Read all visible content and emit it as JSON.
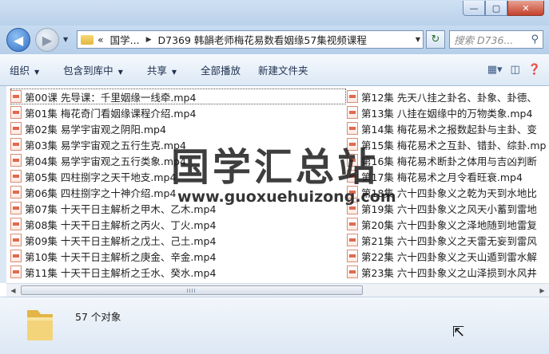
{
  "window": {
    "minimize": "—",
    "maximize": "▢",
    "close": "✕"
  },
  "nav": {
    "back": "◀",
    "forward": "▶",
    "dropdown": "▼"
  },
  "address": {
    "overflow": "«",
    "crumbs": [
      "国学...",
      "D7369 韩韻老师梅花易数看姻缘57集视频课程"
    ],
    "separator": "▶"
  },
  "refresh_icon": "↻",
  "search": {
    "placeholder": "搜索 D736...",
    "icon": "search-icon"
  },
  "toolbar": {
    "organize": "组织",
    "include_in_library": "包含到库中",
    "share": "共享",
    "play_all": "全部播放",
    "new_folder": "新建文件夹",
    "dd": "▼"
  },
  "files": {
    "left": [
      "第00课 先导课：千里姻缘一线牵.mp4",
      "第01集 梅花奇门看姻缘课程介绍.mp4",
      "第02集 易学宇宙观之阴阳.mp4",
      "第03集 易学宇宙观之五行生克.mp4",
      "第04集 易学宇宙观之五行类象.mp4",
      "第05集 四柱捌字之天干地支.mp4",
      "第06集 四柱捌字之十神介绍.mp4",
      "第07集 十天干日主解析之甲木、乙木.mp4",
      "第08集 十天干日主解析之丙火、丁火.mp4",
      "第09集 十天干日主解析之戊土、己土.mp4",
      "第10集 十天干日主解析之庚金、辛金.mp4",
      "第11集 十天干日主解析之壬水、癸水.mp4"
    ],
    "right": [
      "第12集 先天八挂之卦名、卦象、卦德、",
      "第13集 八挂在姻缘中的万物类象.mp4",
      "第14集 梅花易术之报数起卦与主卦、变",
      "第15集 梅花易术之互卦、错卦、综卦.mp",
      "第16集 梅花易术断卦之体用与吉凶判断",
      "第17集 梅花易术之月令看旺衰.mp4",
      "第18集 六十四卦象义之乾为天到水地比",
      "第19集 六十四卦象义之风天小蓄到雷地",
      "第20集 六十四卦象义之泽地随到地雷复",
      "第21集 六十四卦象义之天雷无妄到雷风",
      "第22集 六十四卦象义之天山遁到雷水解",
      "第23集 六十四卦象义之山泽损到水风井"
    ]
  },
  "scrollbar": {
    "left": "◀",
    "right": "▶"
  },
  "status": {
    "object_count": "57 个对象"
  },
  "watermark": {
    "cn": "国学汇总站",
    "url": "www.guoxuehuizong.com"
  },
  "cursor": "⇱"
}
